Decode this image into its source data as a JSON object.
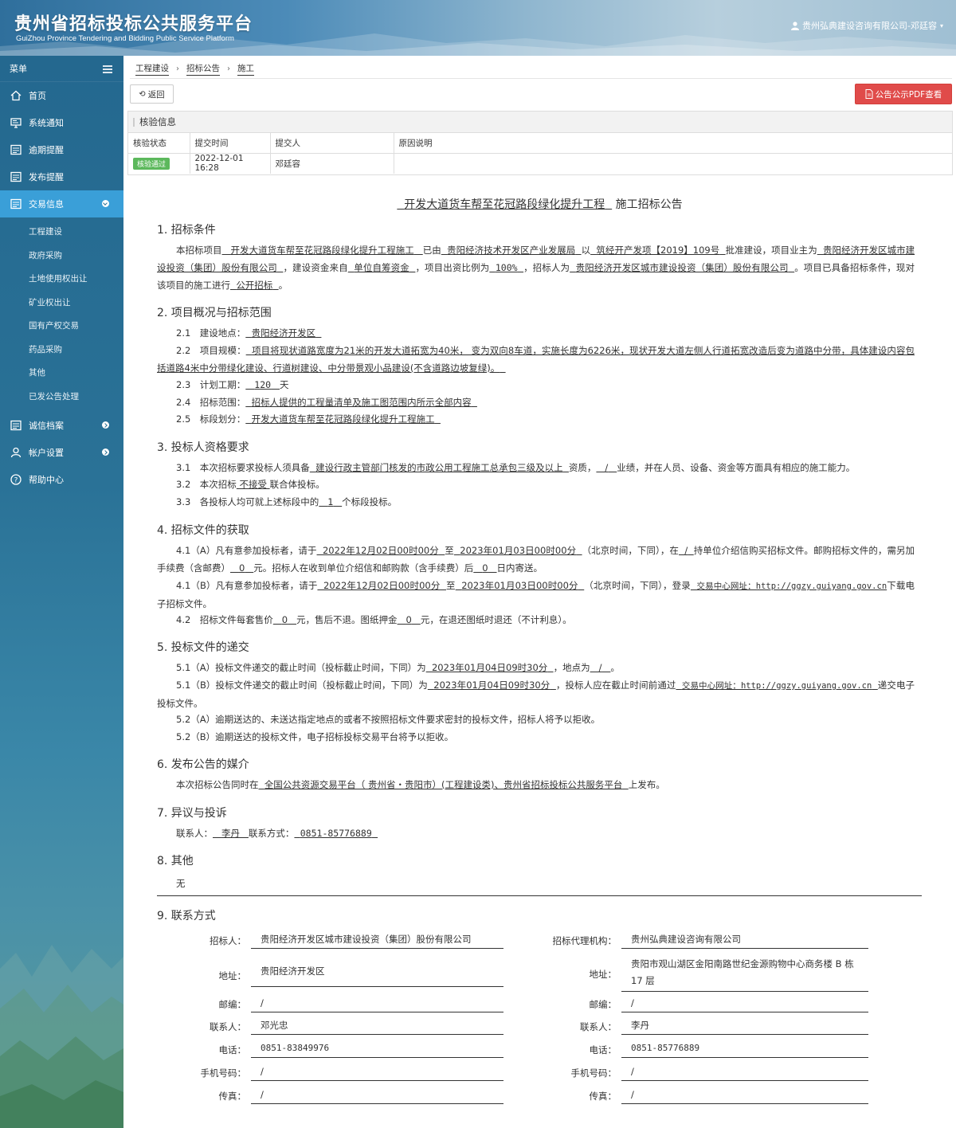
{
  "header": {
    "title": "贵州省招标投标公共服务平台",
    "subtitle": "GuiZhou Province Tendering and Bidding Public Service Platform",
    "user": "贵州弘典建设咨询有限公司-邓廷容"
  },
  "sidebar": {
    "menu_label": "菜单",
    "items": [
      {
        "label": "首页",
        "icon": "home-icon"
      },
      {
        "label": "系统通知",
        "icon": "monitor-icon"
      },
      {
        "label": "逾期提醒",
        "icon": "list-icon"
      },
      {
        "label": "发布提醒",
        "icon": "list-icon"
      },
      {
        "label": "交易信息",
        "icon": "list-icon"
      }
    ],
    "sub_items": [
      "工程建设",
      "政府采购",
      "土地使用权出让",
      "矿业权出让",
      "国有产权交易",
      "药品采购",
      "其他",
      "已发公告处理"
    ],
    "bottom_items": [
      {
        "label": "诚信档案",
        "icon": "list-icon"
      },
      {
        "label": "帐户设置",
        "icon": "user-icon"
      },
      {
        "label": "帮助中心",
        "icon": "help-icon"
      }
    ]
  },
  "breadcrumb": [
    "工程建设",
    "招标公告",
    "施工"
  ],
  "buttons": {
    "back": "返回",
    "pdf": "公告公示PDF查看"
  },
  "verify": {
    "title": "核验信息",
    "headers": [
      "核验状态",
      "提交时间",
      "提交人",
      "原因说明"
    ],
    "row": {
      "status": "核验通过",
      "time": "2022-12-01 16:28",
      "submitter": "邓廷容",
      "reason": ""
    }
  },
  "doc": {
    "title_project": "开发大道货车帮至花冠路段绿化提升工程",
    "title_suffix": "施工招标公告",
    "s1": {
      "h": "1. 招标条件",
      "t1": "本招标项目",
      "project": "开发大道货车帮至花冠路段绿化提升工程施工",
      "t2": "已由",
      "approver": "贵阳经济技术开发区产业发展局",
      "t3": "以",
      "doc_no": "筑经开产发项【2019】109号",
      "t4": "批准建设，项目业主为",
      "owner": "贵阳经济开发区城市建设投资（集团）股份有限公司",
      "t5": "，建设资金来自",
      "fund": "单位自筹资金",
      "t6": "，项目出资比例为",
      "ratio": "100%",
      "t7": "，招标人为",
      "tenderer": "贵阳经济开发区城市建设投资（集团）股份有限公司",
      "t8": "。项目已具备招标条件，现对该项目的施工进行",
      "method": "公开招标",
      "t9": "。"
    },
    "s2": {
      "h": "2. 项目概况与招标范围",
      "l1": "2.1　建设地点：",
      "site": "贵阳经济开发区",
      "l2": "2.2　项目规模：",
      "scale": "项目将现状道路宽度为21米的开发大道拓宽为40米， 变为双向8车道，实施长度为6226米，现状开发大道左侧人行道拓宽改造后变为道路中分带，具体建设内容包括道路4米中分带绿化建设、行道树建设、中分带景观小品建设(不含道路边坡复绿)。",
      "l3": "2.3　计划工期：",
      "period": "120",
      "period_unit": "天",
      "l4": "2.4　招标范围：",
      "range": "招标人提供的工程量清单及施工图范围内所示全部内容",
      "l5": "2.5　标段划分：",
      "section": "开发大道货车帮至花冠路段绿化提升工程施工"
    },
    "s3": {
      "h": "3. 投标人资格要求",
      "l1a": "3.1　本次招标要求投标人须具备",
      "qual": "建设行政主管部门核发的市政公用工程施工总承包三级及以上",
      "l1b": "资质，",
      "perf": "/",
      "l1c": "业绩，并在人员、设备、资金等方面具有相应的施工能力。",
      "l2a": "3.2　本次招标",
      "joint": "不接受",
      "l2b": "联合体投标。",
      "l3a": "3.3　各投标人均可就上述标段中的",
      "count": "1",
      "l3b": "个标段投标。"
    },
    "s4": {
      "h": "4. 招标文件的获取",
      "a1": "4.1（A）凡有意参加投标者，请于",
      "start": "2022年12月02日00时00分",
      "to": "至",
      "end": "2023年01月03日00时00分",
      "a2": "（北京时间，下同），在",
      "place": "/",
      "a3": "持单位介绍信购买招标文件。邮购招标文件的，需另加手续费（含邮费）",
      "fee": "0",
      "a4": "元。招标人在收到单位介绍信和邮购款（含手续费）后",
      "days": "0",
      "a5": "日内寄送。",
      "b1": "4.1（B）凡有意参加投标者，请于",
      "b2": "（北京时间，下同），登录",
      "site": "交易中心网址：http://ggzy.guiyang.gov.cn",
      "b3": "下载电子招标文件。",
      "c1": "4.2　招标文件每套售价",
      "price": "0",
      "c2": "元，售后不退。图纸押金",
      "deposit": "0",
      "c3": "元，在退还图纸时退还（不计利息）。"
    },
    "s5": {
      "h": "5. 投标文件的递交",
      "a1": "5.1（A）投标文件递交的截止时间（投标截止时间，下同）为",
      "deadline": "2023年01月04日09时30分",
      "a2": "，地点为",
      "place": "/",
      "a3": "。",
      "b1": "5.1（B）投标文件递交的截止时间（投标截止时间，下同）为",
      "b2": "，投标人应在截止时间前通过",
      "site": "交易中心网址：http://ggzy.guiyang.gov.cn",
      "b3": "递交电子投标文件。",
      "c": "5.2（A）逾期送达的、未送达指定地点的或者不按照招标文件要求密封的投标文件，招标人将予以拒收。",
      "d": "5.2（B）逾期送达的投标文件，电子招标投标交易平台将予以拒收。"
    },
    "s6": {
      "h": "6. 发布公告的媒介",
      "a": "本次招标公告同时在",
      "media": "全国公共资源交易平台（ 贵州省・贵阳市）(工程建设类)、贵州省招标投标公共服务平台",
      "b": "上发布。"
    },
    "s7": {
      "h": "7. 异议与投诉",
      "a": "联系人：",
      "name": "李丹",
      "b": "联系方式：",
      "phone": "0851-85776889"
    },
    "s8": {
      "h": "8. 其他",
      "text": "无"
    },
    "s9": {
      "h": "9. 联系方式",
      "left": [
        {
          "label": "招标人：",
          "value": "贵阳经济开发区城市建设投资（集团）股份有限公司"
        },
        {
          "label": "地址：",
          "value": "贵阳经济开发区"
        },
        {
          "label": "邮编：",
          "value": "/"
        },
        {
          "label": "联系人：",
          "value": "邓光忠"
        },
        {
          "label": "电话：",
          "value": "0851-83849976"
        },
        {
          "label": "手机号码：",
          "value": "/"
        },
        {
          "label": "传真：",
          "value": "/"
        }
      ],
      "right": [
        {
          "label": "招标代理机构：",
          "value": "贵州弘典建设咨询有限公司"
        },
        {
          "label": "地址：",
          "value": "贵阳市观山湖区金阳南路世纪金源购物中心商务楼 B 栋 17 层"
        },
        {
          "label": "邮编：",
          "value": "/"
        },
        {
          "label": "联系人：",
          "value": "李丹"
        },
        {
          "label": "电话：",
          "value": "0851-85776889"
        },
        {
          "label": "手机号码：",
          "value": "/"
        },
        {
          "label": "传真：",
          "value": "/"
        }
      ]
    }
  }
}
